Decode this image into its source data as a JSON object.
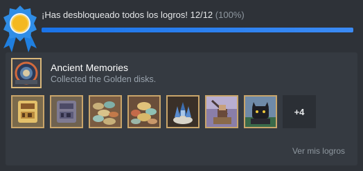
{
  "notification": {
    "unlock_text": "¡Has desbloqueado todos los logros! 12/12",
    "percent_text": "(100%)",
    "progress": 1.0,
    "badge_icon": "award-ribbon-icon"
  },
  "featured": {
    "icon": "golden-disk-emblem-icon",
    "title": "Ancient Memories",
    "description": "Collected the Golden disks."
  },
  "achievements": {
    "icons": [
      "gold-tablet-icon",
      "stone-tablet-icon",
      "coin-pile-icon",
      "treasure-hoard-icon",
      "crystal-shrine-icon",
      "sword-warrior-icon",
      "black-cat-icon"
    ],
    "more_label": "+4"
  },
  "footer": {
    "link_label": "Ver mis logros"
  }
}
